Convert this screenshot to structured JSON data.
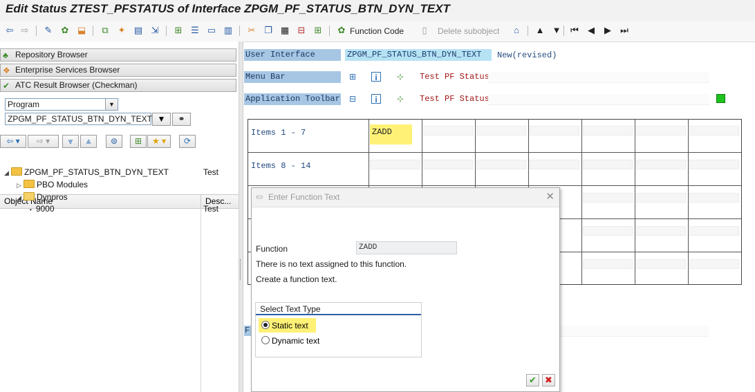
{
  "window": {
    "title": "Edit Status ZTEST_PFSTATUS of Interface ZPGM_PF_STATUS_BTN_DYN_TEXT"
  },
  "toolbar": {
    "function_code_label": "Function Code",
    "delete_subobject_label": "Delete subobject"
  },
  "left": {
    "buttons": [
      "Repository Browser",
      "Enterprise Services Browser",
      "ATC Result Browser (Checkman)"
    ],
    "object_type": "Program",
    "object_name": "ZPGM_PF_STATUS_BTN_DYN_TEXT",
    "tree_header": {
      "name": "Object Name",
      "desc": "Desc..."
    },
    "tree": {
      "root": {
        "label": "ZPGM_PF_STATUS_BTN_DYN_TEXT",
        "desc": "Test"
      },
      "pbo": "PBO Modules",
      "dynpros": "Dynpros",
      "screen": {
        "label": "9000",
        "desc": "Test"
      }
    }
  },
  "right": {
    "user_interface_label": "User Interface",
    "user_interface_value": "ZPGM_PF_STATUS_BTN_DYN_TEXT",
    "status_value": "New(revised)",
    "menu_bar_label": "Menu Bar",
    "menu_bar_text": "Test PF Status",
    "app_toolbar_label": "Application Toolbar",
    "app_toolbar_text": "Test PF Status",
    "rows": [
      {
        "label": "Items  1 -  7",
        "first": "ZADD"
      },
      {
        "label": "Items  8 - 14",
        "first": ""
      }
    ],
    "partial_label": "F"
  },
  "dialog": {
    "title": "Enter Function Text",
    "function_label": "Function",
    "function_value": "ZADD",
    "msg1": "There is no text assigned to this function.",
    "msg2": "Create a function text.",
    "group_title": "Select Text Type",
    "options": [
      "Static text",
      "Dynamic text"
    ],
    "selected": "Static text"
  },
  "colors": {
    "label_blue": "#a7c6e4",
    "value_cyan": "#b6e2f4",
    "highlight_yellow": "#fff176",
    "status_green": "#1ec21e",
    "ok_green": "#3a9a2a",
    "cancel_red": "#d02020"
  }
}
